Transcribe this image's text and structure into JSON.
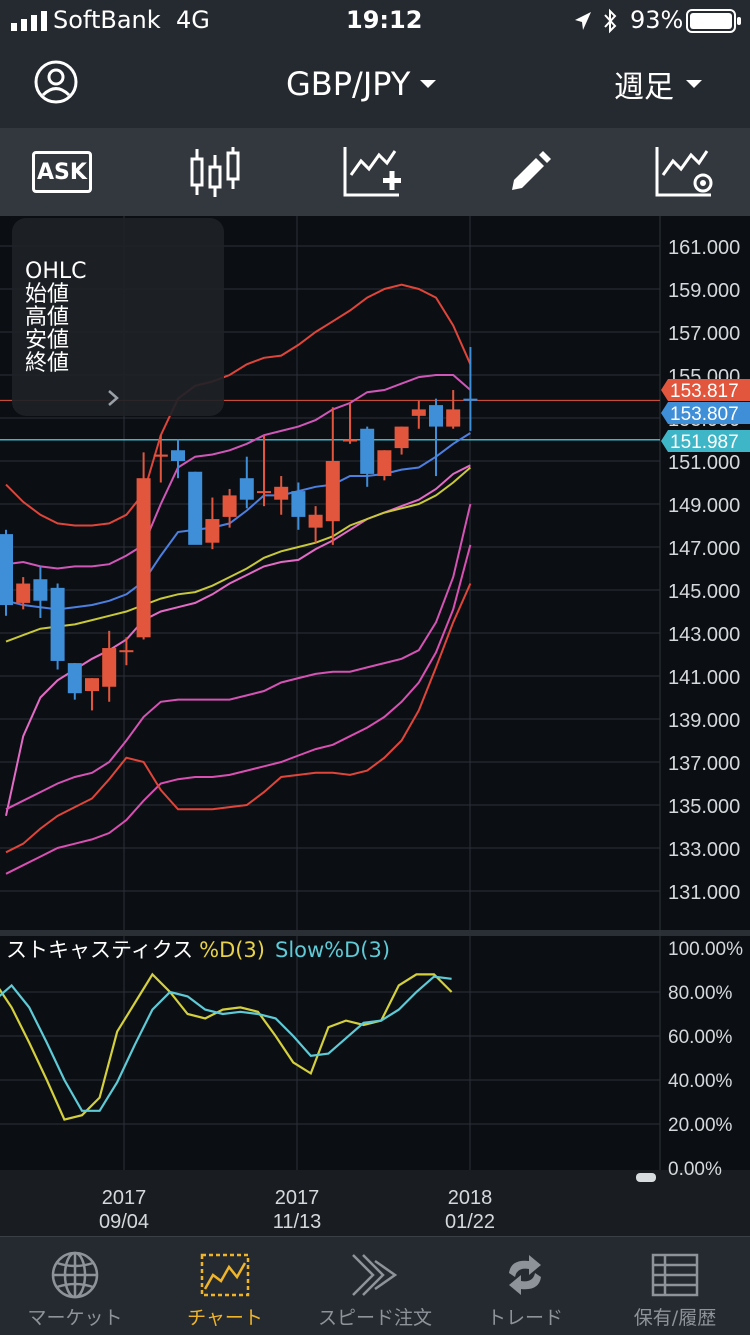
{
  "status_bar": {
    "carrier": "SoftBank",
    "network": "4G",
    "time": "19:12",
    "battery": "93%"
  },
  "header": {
    "pair": "GBP/JPY",
    "period": "週足"
  },
  "toolbar": {
    "ask_label": "ASK"
  },
  "ohlc_panel": {
    "title": "OHLC",
    "rows": [
      "始値",
      "高値",
      "安値",
      "終値"
    ]
  },
  "price_axis": {
    "ticks": [
      "161.000",
      "159.000",
      "157.000",
      "155.000",
      "153.000",
      "151.000",
      "149.000",
      "147.000",
      "145.000",
      "143.000",
      "141.000",
      "139.000",
      "137.000",
      "135.000",
      "133.000",
      "131.000"
    ],
    "markers": [
      {
        "label": "153.817",
        "value": 153.817,
        "color": "#e2563d"
      },
      {
        "label": "153.807",
        "value": 153.807,
        "color": "#3f8ed8"
      },
      {
        "label": "151.987",
        "value": 151.987,
        "color": "#3fb6c7"
      }
    ]
  },
  "indicator": {
    "name": "ストキャスティクス",
    "line1": "%D(3)",
    "line2": "Slow%D(3)",
    "ticks": [
      "100.00%",
      "80.00%",
      "60.00%",
      "40.00%",
      "20.00%",
      "0.00%"
    ]
  },
  "time_axis": [
    {
      "year": "2017",
      "date": "09/04"
    },
    {
      "year": "2017",
      "date": "11/13"
    },
    {
      "year": "2018",
      "date": "01/22"
    }
  ],
  "tabs": [
    {
      "label": "マーケット",
      "icon": "globe-icon",
      "active": false
    },
    {
      "label": "チャート",
      "icon": "chart-icon",
      "active": true
    },
    {
      "label": "スピード注文",
      "icon": "speed-order-icon",
      "active": false
    },
    {
      "label": "トレード",
      "icon": "trade-icon",
      "active": false
    },
    {
      "label": "保有/履歴",
      "icon": "history-icon",
      "active": false
    }
  ],
  "colors": {
    "up": "#e2563d",
    "down": "#3f8ed8",
    "accent": "#f0b429",
    "bg": "#0b0f14"
  },
  "chart_data": {
    "type": "candlestick",
    "ylim": [
      129.5,
      162.5
    ],
    "candles": [
      {
        "o": 147.6,
        "h": 147.8,
        "l": 143.8,
        "c": 144.3
      },
      {
        "o": 144.4,
        "h": 145.6,
        "l": 144.1,
        "c": 145.3
      },
      {
        "o": 145.5,
        "h": 146.1,
        "l": 143.7,
        "c": 144.5
      },
      {
        "o": 145.1,
        "h": 145.3,
        "l": 141.3,
        "c": 141.7
      },
      {
        "o": 141.6,
        "h": 141.6,
        "l": 139.9,
        "c": 140.2
      },
      {
        "o": 140.3,
        "h": 140.9,
        "l": 139.4,
        "c": 140.9
      },
      {
        "o": 140.5,
        "h": 143.1,
        "l": 139.8,
        "c": 142.3
      },
      {
        "o": 142.2,
        "h": 142.8,
        "l": 141.5,
        "c": 142.2
      },
      {
        "o": 142.8,
        "h": 151.4,
        "l": 142.7,
        "c": 150.2
      },
      {
        "o": 151.2,
        "h": 152.2,
        "l": 150.0,
        "c": 151.3
      },
      {
        "o": 151.5,
        "h": 152.0,
        "l": 150.2,
        "c": 151.0
      },
      {
        "o": 150.5,
        "h": 150.5,
        "l": 147.2,
        "c": 147.1
      },
      {
        "o": 147.2,
        "h": 149.3,
        "l": 146.9,
        "c": 148.3
      },
      {
        "o": 148.4,
        "h": 149.7,
        "l": 147.9,
        "c": 149.4
      },
      {
        "o": 150.2,
        "h": 151.2,
        "l": 148.8,
        "c": 149.2
      },
      {
        "o": 149.6,
        "h": 152.2,
        "l": 148.9,
        "c": 149.6
      },
      {
        "o": 149.2,
        "h": 150.3,
        "l": 148.5,
        "c": 149.8
      },
      {
        "o": 149.6,
        "h": 150.0,
        "l": 147.8,
        "c": 148.4
      },
      {
        "o": 147.9,
        "h": 148.9,
        "l": 147.2,
        "c": 148.5
      },
      {
        "o": 148.2,
        "h": 153.5,
        "l": 147.1,
        "c": 151.0
      },
      {
        "o": 152.0,
        "h": 153.7,
        "l": 151.8,
        "c": 152.0
      },
      {
        "o": 152.5,
        "h": 152.6,
        "l": 149.8,
        "c": 150.4
      },
      {
        "o": 150.3,
        "h": 151.5,
        "l": 150.1,
        "c": 151.5
      },
      {
        "o": 151.6,
        "h": 152.6,
        "l": 151.3,
        "c": 152.6
      },
      {
        "o": 153.1,
        "h": 153.8,
        "l": 152.5,
        "c": 153.4
      },
      {
        "o": 153.6,
        "h": 153.9,
        "l": 150.3,
        "c": 152.6
      },
      {
        "o": 152.6,
        "h": 154.3,
        "l": 152.5,
        "c": 153.4
      },
      {
        "o": 153.9,
        "h": 156.3,
        "l": 152.4,
        "c": 153.8
      }
    ],
    "bands": {
      "sma": [
        134.5,
        138.2,
        140.0,
        140.8,
        141.3,
        141.8,
        142.2,
        142.7,
        143.6,
        144.0,
        144.2,
        144.4,
        144.8,
        145.3,
        145.7,
        146.1,
        146.3,
        146.4,
        146.9,
        147.3,
        147.8,
        148.3,
        148.6,
        148.9,
        149.2,
        149.7,
        150.4,
        150.8
      ],
      "upper1": [
        146.2,
        146.3,
        146.1,
        146.0,
        146.1,
        146.1,
        146.2,
        146.6,
        147.1,
        149.0,
        150.7,
        151.2,
        151.3,
        151.5,
        151.8,
        152.2,
        152.4,
        152.6,
        152.9,
        153.4,
        153.7,
        154.2,
        154.3,
        154.6,
        154.9,
        155.0,
        155.0,
        154.3
      ],
      "upper2": [
        149.9,
        149.1,
        148.5,
        148.1,
        148.0,
        148.0,
        148.1,
        148.5,
        149.5,
        152.2,
        153.9,
        154.5,
        154.7,
        155.0,
        155.5,
        155.8,
        155.9,
        156.4,
        157.0,
        157.5,
        158.0,
        158.6,
        159.0,
        159.2,
        159.0,
        158.6,
        157.3,
        155.5
      ],
      "lower1": [
        134.8,
        135.2,
        135.6,
        136.0,
        136.3,
        136.5,
        137.0,
        138.0,
        139.1,
        139.8,
        139.9,
        139.9,
        139.9,
        139.9,
        140.1,
        140.3,
        140.7,
        140.9,
        141.1,
        141.2,
        141.2,
        141.4,
        141.6,
        141.8,
        142.2,
        143.5,
        145.6,
        149.0
      ],
      "lower2": [
        131.8,
        132.2,
        132.6,
        133.0,
        133.2,
        133.4,
        133.7,
        134.3,
        135.2,
        136.0,
        136.2,
        136.3,
        136.3,
        136.4,
        136.6,
        136.8,
        137.0,
        137.3,
        137.6,
        137.8,
        138.2,
        138.6,
        139.1,
        139.8,
        140.7,
        142.1,
        144.1,
        147.1
      ],
      "lower3": [
        132.8,
        133.2,
        133.9,
        134.5,
        134.9,
        135.3,
        136.2,
        137.2,
        137.0,
        135.7,
        134.8,
        134.8,
        134.8,
        134.9,
        135.0,
        135.6,
        136.3,
        136.4,
        136.5,
        136.5,
        136.4,
        136.6,
        137.2,
        138.0,
        139.4,
        141.4,
        143.5,
        145.3
      ]
    },
    "ma_blue": [
      144.5,
      144.3,
      144.2,
      144.1,
      144.2,
      144.3,
      144.5,
      144.8,
      145.4,
      146.6,
      147.7,
      147.8,
      147.9,
      148.1,
      148.7,
      149.4,
      149.4,
      149.6,
      149.8,
      149.9,
      150.3,
      150.3,
      150.4,
      150.6,
      150.7,
      151.2,
      151.8,
      152.3
    ],
    "ma_yellow": [
      142.6,
      142.9,
      143.2,
      143.3,
      143.4,
      143.6,
      143.8,
      144.0,
      144.3,
      144.6,
      144.8,
      144.9,
      145.2,
      145.6,
      146.0,
      146.5,
      146.8,
      147.0,
      147.2,
      147.5,
      148.0,
      148.3,
      148.6,
      148.8,
      149.0,
      149.4,
      150.0,
      150.7
    ],
    "stoch_d": [
      85,
      73,
      57,
      40,
      22,
      24,
      32,
      62,
      75,
      88,
      80,
      70,
      68,
      72,
      73,
      71,
      60,
      48,
      43,
      64,
      67,
      65,
      67,
      83,
      88,
      88,
      80
    ],
    "stoch_slow": [
      76,
      83,
      73,
      57,
      40,
      26,
      26,
      39,
      56,
      72,
      80,
      78,
      72,
      70,
      71,
      70,
      68,
      60,
      51,
      52,
      59,
      66,
      67,
      72,
      80,
      87,
      86
    ]
  }
}
